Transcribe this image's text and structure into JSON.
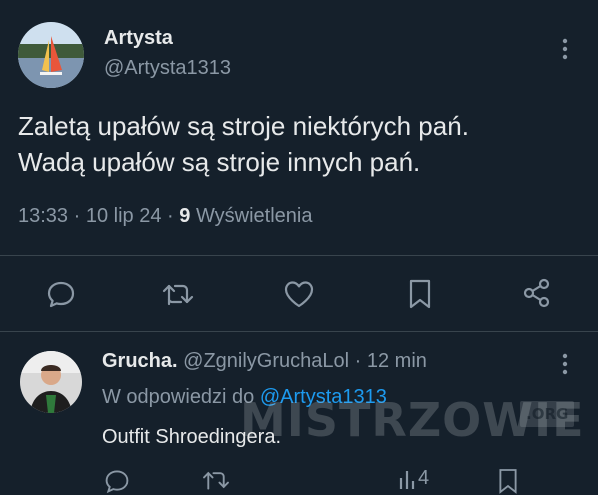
{
  "tweet": {
    "author": {
      "name": "Artysta",
      "handle": "@Artysta1313"
    },
    "text_line1": "Zaletą upałów są stroje niektórych pań.",
    "text_line2": "Wadą upałów są stroje innych pań.",
    "meta": {
      "time": "13:33",
      "sep1": "·",
      "date": "10 lip 24",
      "sep2": "·",
      "views_count": "9",
      "views_label": "Wyświetlenia"
    },
    "more_icon": "more-vertical-icon",
    "actions": [
      "reply-icon",
      "retweet-icon",
      "like-icon",
      "bookmark-icon",
      "share-icon"
    ]
  },
  "reply": {
    "author": {
      "name": "Grucha.",
      "handle": "@ZgnilyGruchaLol",
      "sep": "·",
      "time": "12 min"
    },
    "in_reply_prefix": "W odpowiedzi do",
    "in_reply_handle": "@Artysta1313",
    "text": "Outfit Shroedingera.",
    "partial_action_text": "4"
  },
  "watermark": {
    "text": "MISTRZOWIE",
    "badge": ".ORG"
  },
  "colors": {
    "background": "#15202b",
    "text": "#e7e9ea",
    "muted": "#8b98a5",
    "link": "#1d9bf0",
    "divider": "#38444d"
  }
}
